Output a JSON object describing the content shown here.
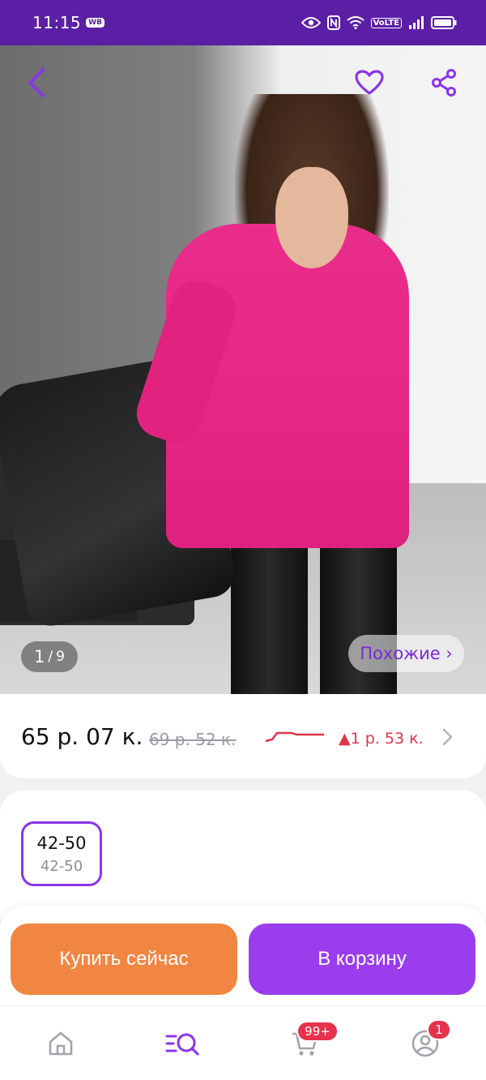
{
  "status_bar": {
    "time": "11:15",
    "app_badge": "WB",
    "volte": "VoLTE"
  },
  "gallery": {
    "counter_current": "1",
    "counter_separator": "/",
    "counter_total": "9",
    "similar_label": "Похожие ›"
  },
  "price": {
    "current": "65 р. 07 к.",
    "old": "69 р. 52 к.",
    "change": "▲1 р. 53 к."
  },
  "sizes": [
    {
      "main": "42-50",
      "sub": "42-50"
    }
  ],
  "actions": {
    "buy_now": "Купить сейчас",
    "add_to_cart": "В корзину"
  },
  "nav": {
    "cart_badge": "99+",
    "profile_badge": "1"
  },
  "colors": {
    "brand_purple": "#5b1fa6",
    "accent_purple": "#9a3ded",
    "buy_orange": "#f08642",
    "price_up_red": "#e0344a"
  },
  "icons": [
    "back-icon",
    "heart-icon",
    "share-icon",
    "home-icon",
    "catalog-search-icon",
    "cart-icon",
    "profile-icon"
  ]
}
